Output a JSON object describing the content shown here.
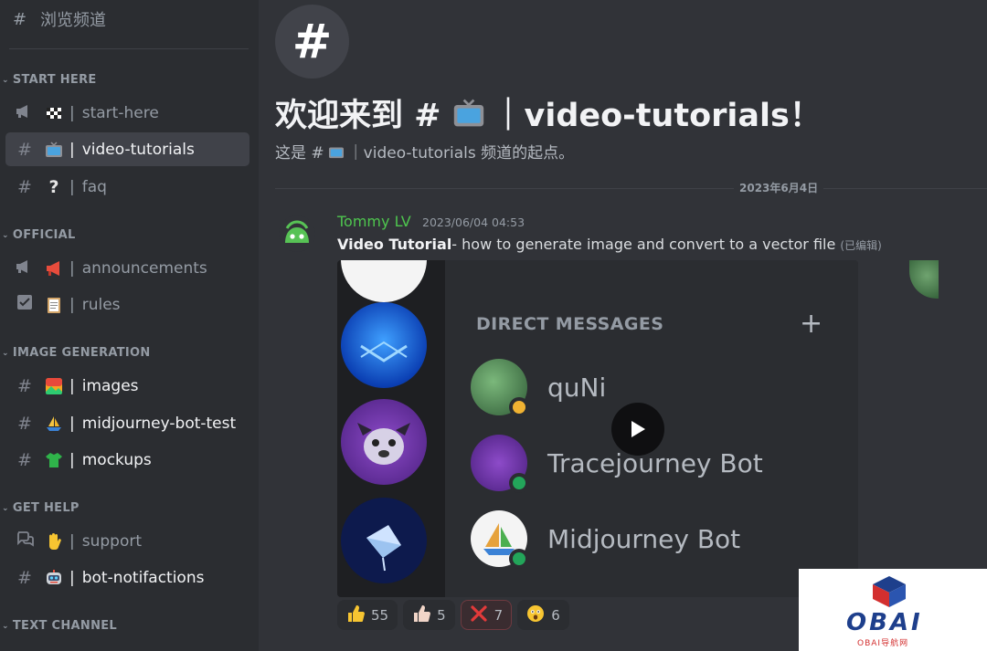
{
  "sidebar": {
    "browse_label": "浏览频道",
    "categories": [
      {
        "label": "START HERE"
      },
      {
        "label": "OFFICIAL"
      },
      {
        "label": "IMAGE GENERATION"
      },
      {
        "label": "GET HELP"
      },
      {
        "label": "TEXT CHANNEL"
      }
    ],
    "channels": [
      {
        "label": "start-here",
        "type": "announcement-icon",
        "emoji": "checkered-flag"
      },
      {
        "label": "video-tutorials",
        "type": "hash-icon",
        "emoji": "tv",
        "active": true
      },
      {
        "label": "faq",
        "type": "hash-icon",
        "emoji": "question-mark"
      },
      {
        "label": "announcements",
        "type": "announcement-icon",
        "emoji": "megaphone"
      },
      {
        "label": "rules",
        "type": "checkbox-icon",
        "emoji": "clipboard"
      },
      {
        "label": "images",
        "type": "hash-icon",
        "emoji": "picture"
      },
      {
        "label": "midjourney-bot-test",
        "type": "hash-icon",
        "emoji": "sailboat"
      },
      {
        "label": "mockups",
        "type": "hash-icon",
        "emoji": "tshirt"
      },
      {
        "label": "support",
        "type": "forum-icon",
        "emoji": "raised-hand"
      },
      {
        "label": "bot-notifactions",
        "type": "hash-icon",
        "emoji": "robot"
      }
    ],
    "separator": "|"
  },
  "channel_header": {
    "welcome_prefix": "欢迎来到 #",
    "welcome_suffix": "｜video-tutorials！",
    "subtitle_prefix": "这是 #",
    "subtitle_suffix": "｜video-tutorials 频道的起点。"
  },
  "date_divider": "2023年6月4日",
  "message": {
    "author": "Tommy LV",
    "timestamp": "2023/06/04 04:53",
    "bold": "Video Tutorial",
    "text": "- how to generate image and convert to a vector file",
    "edited": "(已编辑)"
  },
  "video": {
    "dm_title": "DIRECT MESSAGES",
    "dm_plus": "+",
    "dms": [
      {
        "name": "quNi"
      },
      {
        "name": "Tracejourney Bot"
      },
      {
        "name": "Midjourney Bot"
      }
    ]
  },
  "reactions": [
    {
      "emoji": "thumbs-up",
      "count": "55"
    },
    {
      "emoji": "thumbs-up-light",
      "count": "5"
    },
    {
      "emoji": "cross-mark",
      "count": "7"
    },
    {
      "emoji": "astonished",
      "count": "6"
    }
  ],
  "watermark": {
    "text": "OBAI",
    "sub": "OBAI导航网"
  },
  "colors": {
    "accent": "#5865f2",
    "author": "#4ec54e",
    "online": "#23a55a"
  }
}
